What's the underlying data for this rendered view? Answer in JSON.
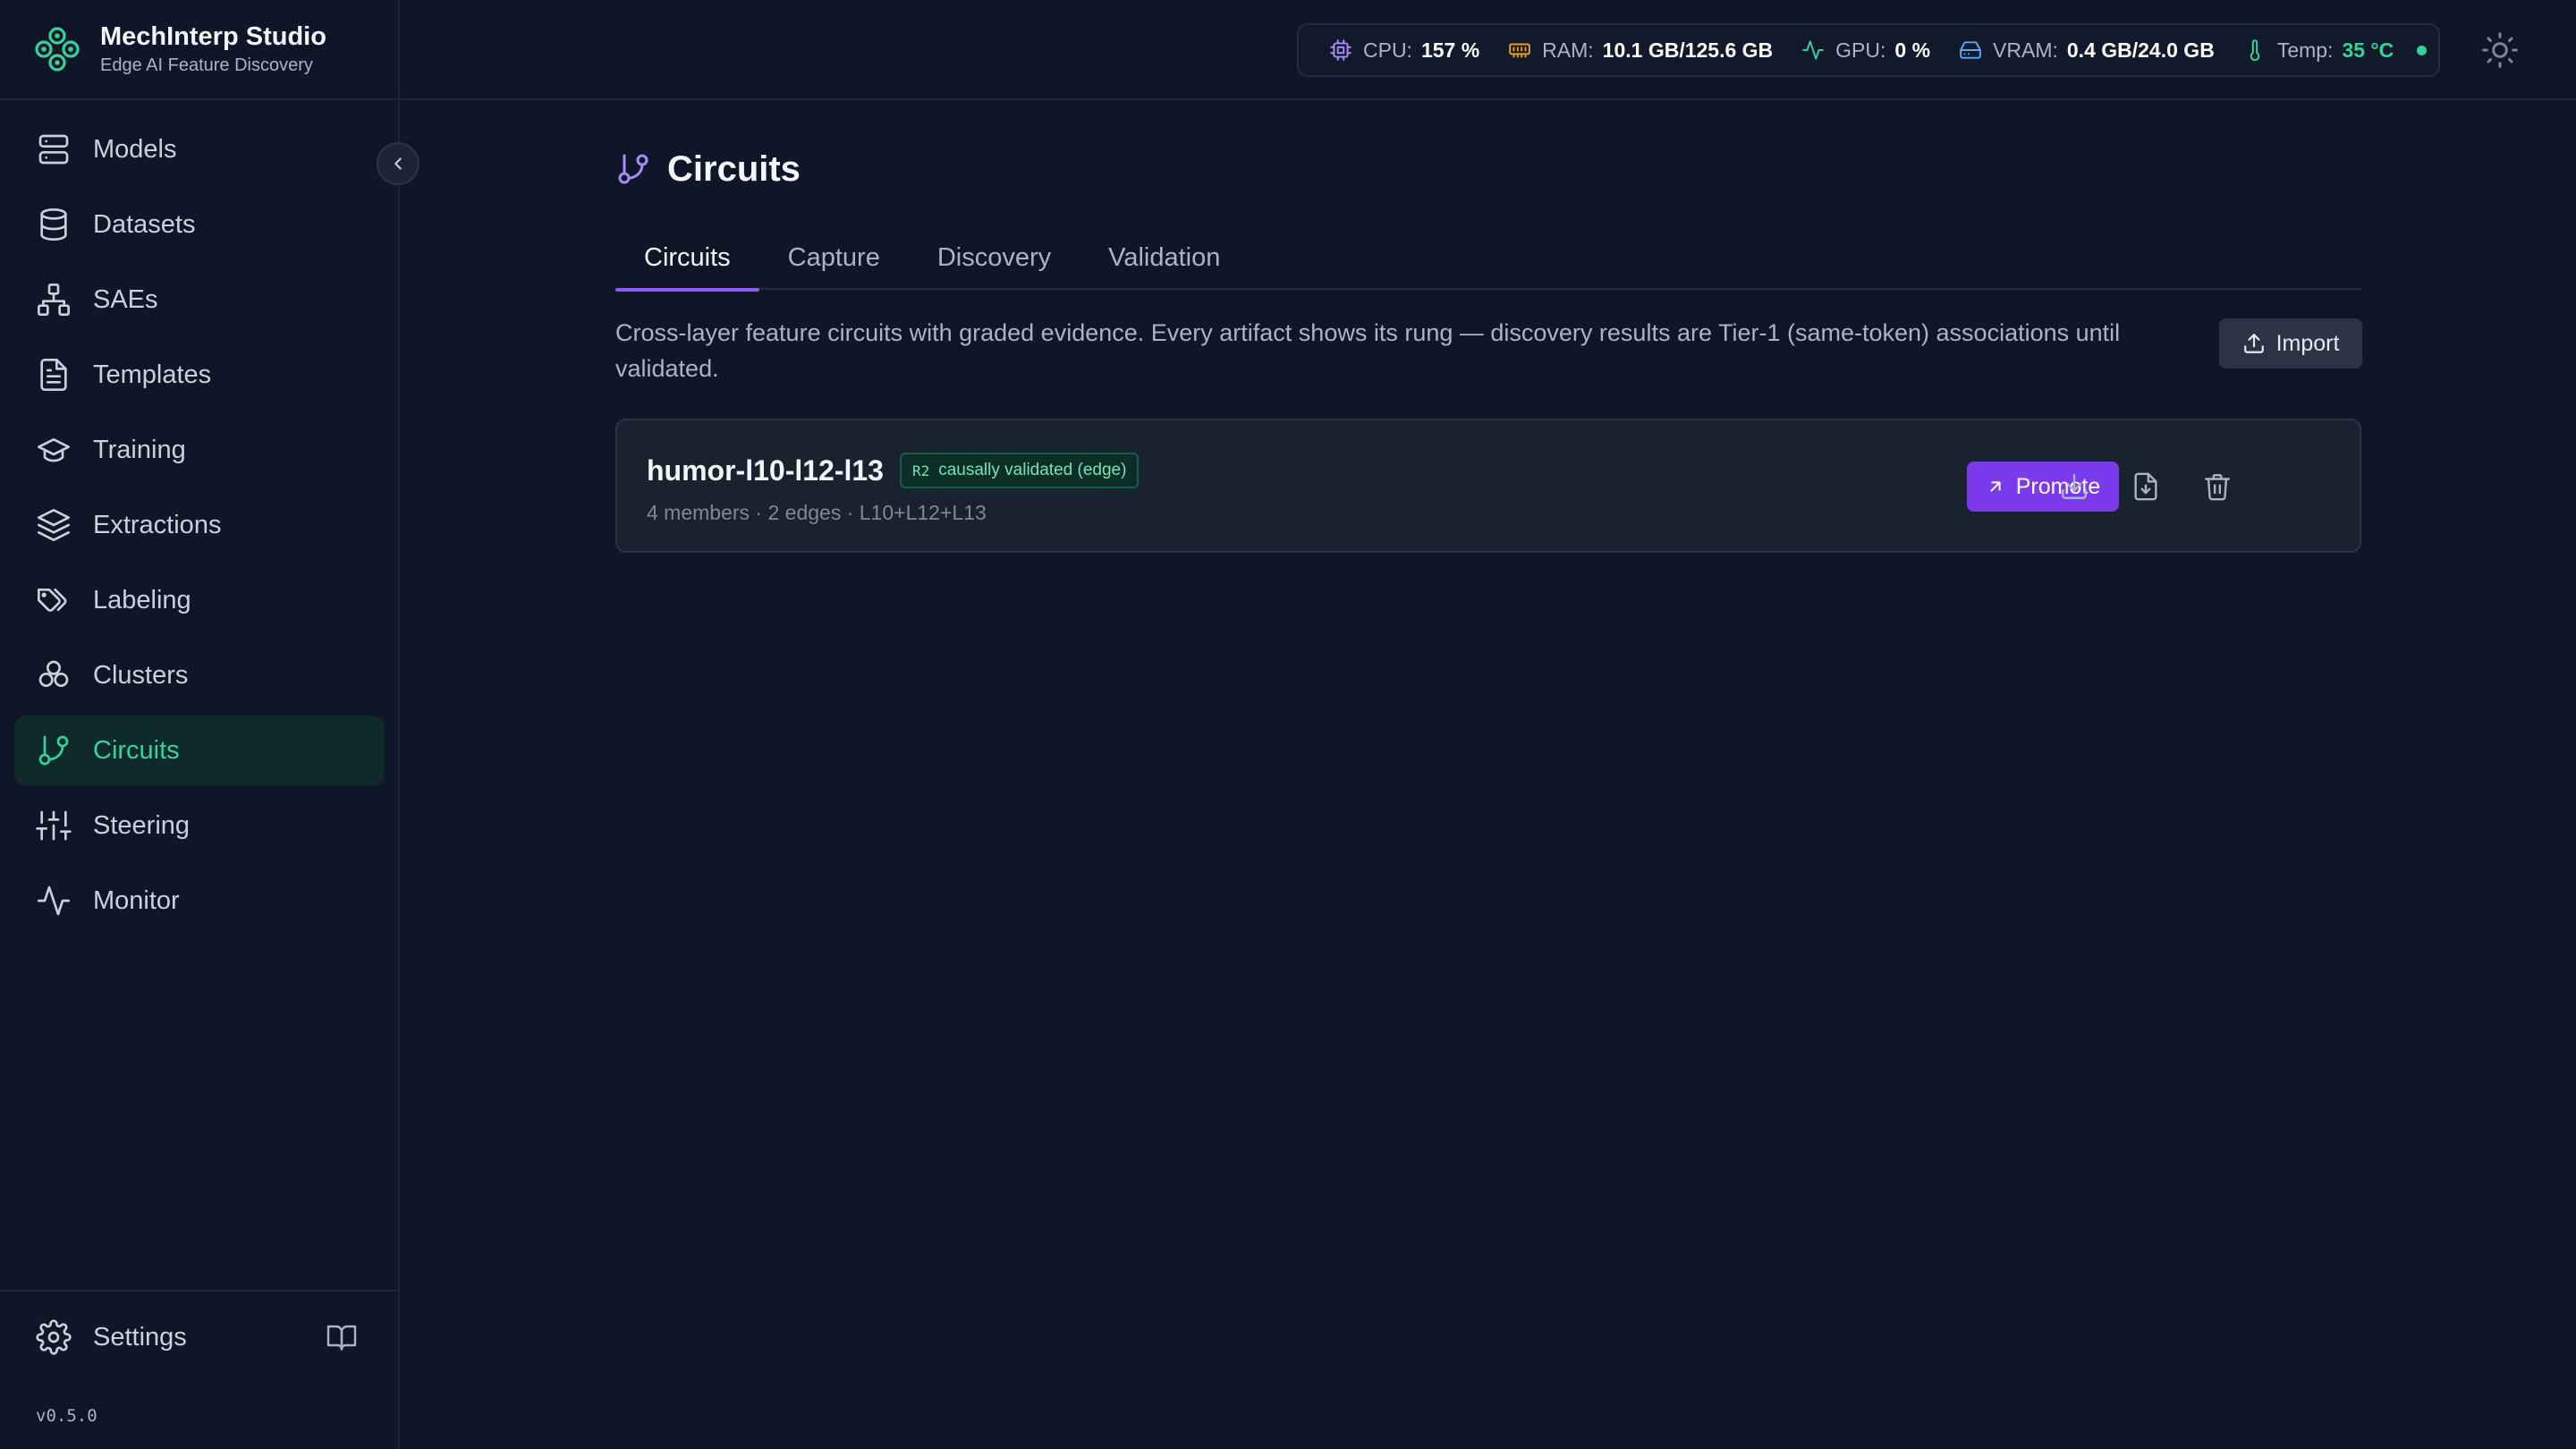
{
  "brand": {
    "title": "MechInterp Studio",
    "subtitle": "Edge AI Feature Discovery",
    "logo_icon": "cluster-logo-icon"
  },
  "sidebar": {
    "items": [
      {
        "label": "Models",
        "icon": "server-icon",
        "active": false
      },
      {
        "label": "Datasets",
        "icon": "database-icon",
        "active": false
      },
      {
        "label": "SAEs",
        "icon": "network-icon",
        "active": false
      },
      {
        "label": "Templates",
        "icon": "file-text-icon",
        "active": false
      },
      {
        "label": "Training",
        "icon": "graduation-cap-icon",
        "active": false
      },
      {
        "label": "Extractions",
        "icon": "layers-icon",
        "active": false
      },
      {
        "label": "Labeling",
        "icon": "tags-icon",
        "active": false
      },
      {
        "label": "Clusters",
        "icon": "clusters-icon",
        "active": false
      },
      {
        "label": "Circuits",
        "icon": "git-branch-icon",
        "active": true
      },
      {
        "label": "Steering",
        "icon": "sliders-icon",
        "active": false
      },
      {
        "label": "Monitor",
        "icon": "activity-icon",
        "active": false
      }
    ],
    "settings_label": "Settings",
    "version": "v0.5.0"
  },
  "metrics": {
    "cpu": {
      "label": "CPU:",
      "value": "157 %",
      "icon": "cpu-icon",
      "color": "#a78bfa"
    },
    "ram": {
      "label": "RAM:",
      "value": "10.1 GB/125.6 GB",
      "icon": "memory-icon",
      "color": "#f59e0b"
    },
    "gpu": {
      "label": "GPU:",
      "value": "0 %",
      "icon": "activity-icon",
      "color": "#34d399"
    },
    "vram": {
      "label": "VRAM:",
      "value": "0.4 GB/24.0 GB",
      "icon": "hard-drive-icon",
      "color": "#60a5fa"
    },
    "temp": {
      "label": "Temp:",
      "value": "35 °C",
      "icon": "thermometer-icon",
      "color": "#34d399"
    }
  },
  "page": {
    "title": "Circuits",
    "tabs": [
      "Circuits",
      "Capture",
      "Discovery",
      "Validation"
    ],
    "active_tab": 0,
    "description": "Cross-layer feature circuits with graded evidence. Every artifact shows its rung — discovery results are Tier-1 (same-token) associations until validated.",
    "import_label": "Import"
  },
  "circuit": {
    "name": "humor-l10-l12-l13",
    "badge_rung": "R2",
    "badge_text": "causally validated (edge)",
    "meta": "4 members · 2 edges · L10+L12+L13",
    "promote_label": "Promote"
  },
  "colors": {
    "accent": "#8b5cf6",
    "active_nav": "#34d399",
    "promote": "#7c3aed"
  }
}
